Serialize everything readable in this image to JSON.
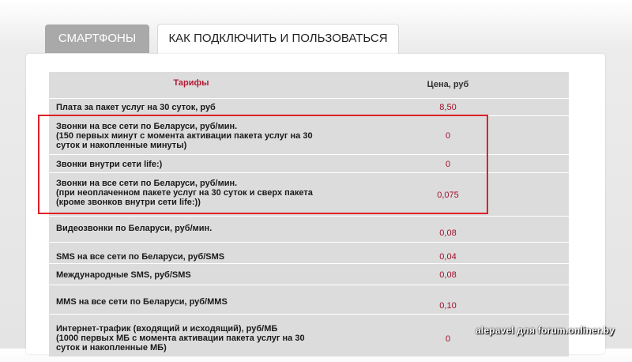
{
  "tabs": [
    {
      "label": "СМАРТФОНЫ"
    },
    {
      "label": "КАК ПОДКЛЮЧИТЬ И ПОЛЬЗОВАТЬСЯ"
    }
  ],
  "table": {
    "header": {
      "name": "Тарифы",
      "price": "Цена, руб"
    },
    "rows": [
      {
        "label": "Плата за пакет услуг на 30 суток, руб",
        "value": "8,50"
      },
      {
        "label": "Звонки на все сети по Беларуси, руб/мин.\n(150 первых минут с момента активации пакета услуг на 30\nсуток и накопленные минуты)",
        "value": "0"
      },
      {
        "label": "Звонки внутри сети life:)",
        "value": "0"
      },
      {
        "label": "Звонки на все сети по Беларуси, руб/мин.\n(при неоплаченном пакете услуг на 30 суток и сверх пакета\n(кроме звонков внутри сети life:))",
        "value": "0,075"
      },
      {
        "label": "Видеозвонки по Беларуси, руб/мин.",
        "value": "0,08"
      },
      {
        "label": "SMS на все сети по Беларуси, руб/SMS",
        "value": "0,04"
      },
      {
        "label": "Международные SMS, руб/SMS",
        "value": "0,08"
      },
      {
        "label": "MMS на все сети по Беларуси, руб/MMS",
        "value": "0,10"
      },
      {
        "label": "Интернет-трафик (входящий и исходящий), руб/МБ\n(1000 первых МБ с момента активации пакета услуг на 30\nсуток и накопленные МБ)",
        "value": "0"
      }
    ]
  },
  "watermark": "alepavel для forum.onliner.by",
  "colors": {
    "value": "#a0102a",
    "header": "#b31b34",
    "highlight": "#e0202a"
  }
}
